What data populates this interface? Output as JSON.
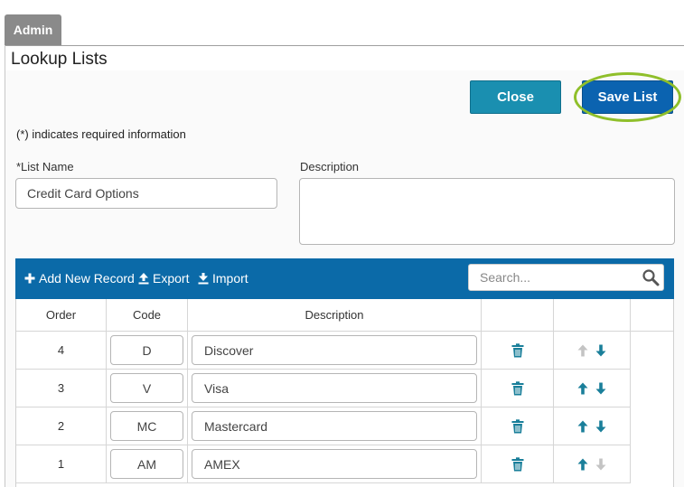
{
  "header": {
    "admin_tab": "Admin",
    "page_title": "Lookup Lists"
  },
  "actions": {
    "close_label": "Close",
    "save_label": "Save List"
  },
  "form": {
    "required_note": "(*) indicates required information",
    "list_name_label": "*List Name",
    "list_name_value": "Credit Card Options",
    "description_label": "Description",
    "description_value": ""
  },
  "toolbar": {
    "add_label": "Add New Record",
    "export_label": "Export",
    "import_label": "Import",
    "search_placeholder": "Search..."
  },
  "table": {
    "columns": [
      "Order",
      "Code",
      "Description",
      "",
      "",
      ""
    ],
    "rows": [
      {
        "order": "4",
        "code": "D",
        "description": "Discover",
        "can_move_up": false,
        "can_move_down": true
      },
      {
        "order": "3",
        "code": "V",
        "description": "Visa",
        "can_move_up": true,
        "can_move_down": true
      },
      {
        "order": "2",
        "code": "MC",
        "description": "Mastercard",
        "can_move_up": true,
        "can_move_down": true
      },
      {
        "order": "1",
        "code": "AM",
        "description": "AMEX",
        "can_move_up": true,
        "can_move_down": false
      }
    ]
  },
  "colors": {
    "toolbar_bg": "#0b6aa8",
    "close_button": "#1a8fb0",
    "save_button": "#0b63b0",
    "highlight_ring": "#8fbf2a",
    "icon_teal": "#1a7f9a",
    "icon_disabled": "#c4c4c4"
  },
  "icons": {
    "add": "plus-icon",
    "export": "upload-icon",
    "import": "download-icon",
    "search": "search-icon",
    "delete": "trash-icon",
    "up": "arrow-up-icon",
    "down": "arrow-down-icon"
  }
}
